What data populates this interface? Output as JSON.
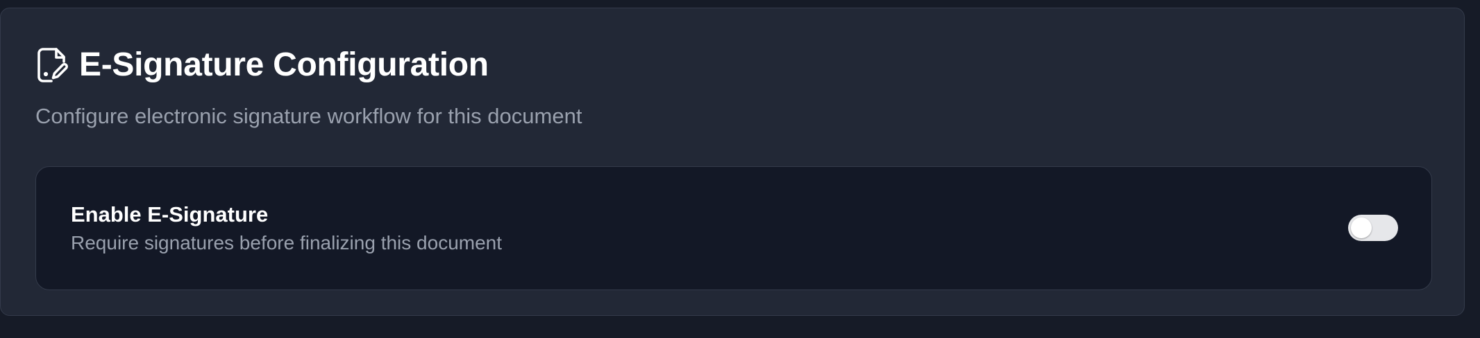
{
  "header": {
    "icon": "file-signature-icon",
    "title": "E-Signature Configuration",
    "subtitle": "Configure electronic signature workflow for this document"
  },
  "setting": {
    "label": "Enable E-Signature",
    "description": "Require signatures before finalizing this document",
    "enabled": false
  },
  "colors": {
    "page_background": "#161b27",
    "card_background": "#222836",
    "row_background": "#131826",
    "border": "#343b4b",
    "title_text": "#ffffff",
    "muted_text": "#9aa1ae",
    "toggle_track_off": "#e6e7ea"
  }
}
